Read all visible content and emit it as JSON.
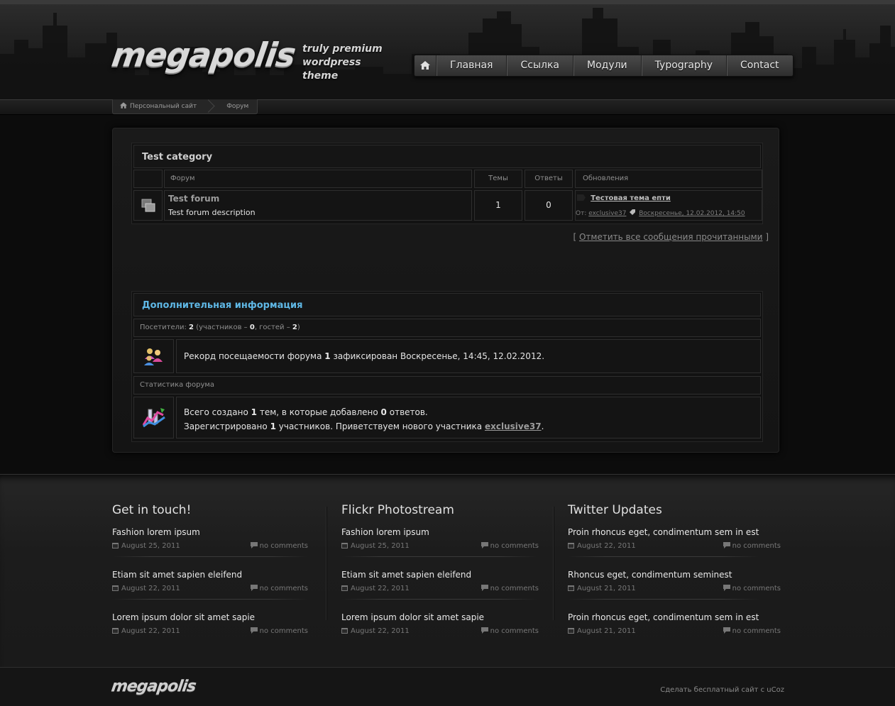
{
  "header": {
    "logo": "megapolis",
    "tagline_1": "truly premium",
    "tagline_2": "wordpress theme",
    "nav": [
      "Главная",
      "Ссылка",
      "Модули",
      "Typography",
      "Contact"
    ]
  },
  "breadcrumb": [
    "Персональный сайт",
    "Форум"
  ],
  "forum": {
    "category_title": "Test category",
    "columns": {
      "forum": "Форум",
      "topics": "Темы",
      "replies": "Ответы",
      "updates": "Обновления"
    },
    "row": {
      "name": "Test forum",
      "description": "Test forum description",
      "topics": "1",
      "replies": "0",
      "last_topic": "Тестовая тема епти",
      "from_label": "От:",
      "last_user": "exclusive37",
      "last_date": "Воскресенье, 12.02.2012, 14:50"
    },
    "mark_read": {
      "open": "[",
      "link": "Отметить все сообщения прочитанными",
      "close": "]"
    }
  },
  "info": {
    "title": "Дополнительная информация",
    "visitors_label": "Посетители:",
    "visitors_total": "2",
    "visitors_detail_1": "(участников –",
    "members": "0",
    "visitors_detail_2": ", гостей –",
    "guests": "2",
    "visitors_detail_3": ")",
    "record_text_1": "Рекорд посещаемости форума",
    "record_count": "1",
    "record_text_2": "зафиксирован Воскресенье, 14:45, 12.02.2012.",
    "stats_label": "Статистика форума",
    "stats_text_1": "Всего создано",
    "stats_topics": "1",
    "stats_text_2": "тем, в которые добавлено",
    "stats_posts": "0",
    "stats_text_3": "ответов.",
    "reg_text_1": "Зарегистрировано",
    "reg_count": "1",
    "reg_text_2": "участников. Приветствуем нового участника",
    "new_user": "exclusive37",
    "reg_text_3": "."
  },
  "footer": {
    "columns": [
      {
        "title": "Get in touch!",
        "posts": [
          {
            "title": "Fashion lorem ipsum",
            "date": "August 25, 2011",
            "comments": "no comments"
          },
          {
            "title": "Etiam sit amet sapien eleifend",
            "date": "August 22, 2011",
            "comments": "no comments"
          },
          {
            "title": "Lorem ipsum dolor sit amet sapie",
            "date": "August 22, 2011",
            "comments": "no comments"
          }
        ]
      },
      {
        "title": "Flickr Photostream",
        "posts": [
          {
            "title": "Fashion lorem ipsum",
            "date": "August 25, 2011",
            "comments": "no comments"
          },
          {
            "title": "Etiam sit amet sapien eleifend",
            "date": "August 22, 2011",
            "comments": "no comments"
          },
          {
            "title": "Lorem ipsum dolor sit amet sapie",
            "date": "August 22, 2011",
            "comments": "no comments"
          }
        ]
      },
      {
        "title": "Twitter Updates",
        "posts": [
          {
            "title": "Proin rhoncus eget, condimentum sem in est",
            "date": "August 22, 2011",
            "comments": "no comments"
          },
          {
            "title": "Rhoncus eget, condimentum seminest",
            "date": "August 21, 2011",
            "comments": "no comments"
          },
          {
            "title": "Proin rhoncus eget, condimentum sem in est",
            "date": "August 21, 2011",
            "comments": "no comments"
          }
        ]
      }
    ],
    "bottom_logo": "megapolis",
    "ucoz_link": "Сделать бесплатный сайт с uCoz"
  },
  "colors": {
    "accent_blue": "#5fb8e6",
    "background": "#0c0c0c",
    "panel": "#141414"
  },
  "icons": [
    "home-icon",
    "forum-folder-icon",
    "users-icon",
    "stats-chart-icon",
    "calendar-icon",
    "comment-bubble-icon",
    "tag-icon",
    "topic-arrow-icon"
  ]
}
